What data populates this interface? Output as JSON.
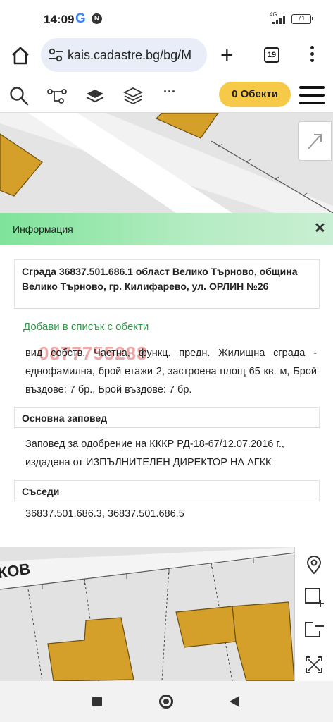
{
  "status_bar": {
    "time": "14:09",
    "google_icon": "google-icon",
    "notification_icon_letter": "N",
    "network_label": "4G",
    "battery": "71"
  },
  "browser": {
    "url": "kais.cadastre.bg/bg/M",
    "tab_count": "19"
  },
  "toolbar": {
    "objects_button": "0 Обекти",
    "more_label": "···"
  },
  "info_panel": {
    "title": "Информация",
    "close_label": "✕",
    "building_title": "Сграда 36837.501.686.1 област Велико Търново, община Велико Търново, гр. Килифарево, ул. ОРЛИН №26",
    "add_to_list": "Добави в списък с обекти",
    "properties": "вид собств. Частна, функц. предн. Жилищна сграда - еднофамилна, брой етажи 2, застроена площ 65 кв. м, Брой въздове: 7 бр., Брой въздове: 7 бр.",
    "watermark_text": "0877755288",
    "main_order_heading": "Основна заповед",
    "main_order_text": "Заповед за одобрение на КККР РД-18-67/12.07.2016 г., издадена от ИЗПЪЛНИТЕЛЕН ДИРЕКТОР НА АГКК",
    "neighbors_heading": "Съседи",
    "neighbors_text": "36837.501.686.3, 36837.501.686.5"
  },
  "map": {
    "street_label_fragment": "КОВ",
    "parcel_color": "#d4a02a",
    "road_color": "#ffffff"
  },
  "colors": {
    "accent_yellow": "#f7c948",
    "link_green": "#2e9a47",
    "header_green": "#7fe39a"
  }
}
